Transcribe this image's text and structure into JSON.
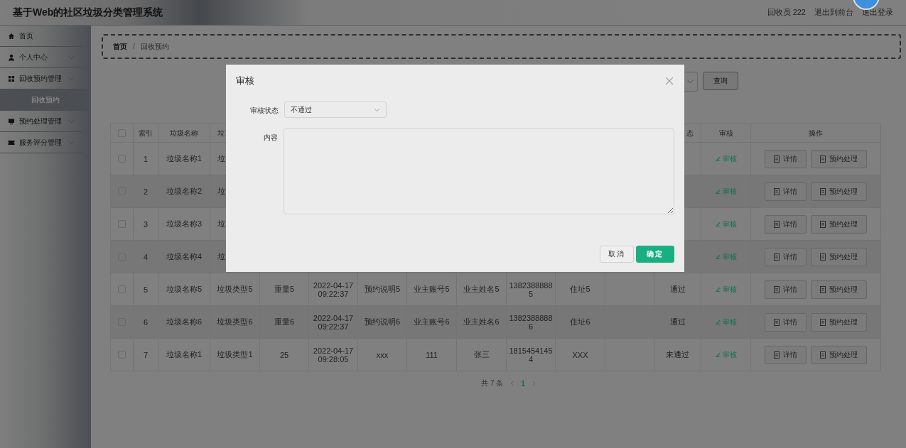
{
  "header": {
    "title": "基于Web的社区垃圾分类管理系统",
    "user": "回收员 222",
    "links": [
      "退出到前台",
      "退出登录"
    ]
  },
  "sidebar": {
    "items": [
      {
        "label": "首页",
        "collapsible": false
      },
      {
        "label": "个人中心",
        "collapsible": true
      },
      {
        "label": "回收预约管理",
        "collapsible": true,
        "children": [
          {
            "label": "回收预约",
            "selected": true
          }
        ]
      },
      {
        "label": "预约处理管理",
        "collapsible": true
      },
      {
        "label": "服务评分管理",
        "collapsible": true
      }
    ]
  },
  "breadcrumb": {
    "items": [
      "首页",
      "回收预约"
    ],
    "separator": "/"
  },
  "search": {
    "button": "查询"
  },
  "table": {
    "header_checkbox": {
      "checked": false
    },
    "columns": [
      "索引",
      "垃圾名称",
      "垃",
      null,
      null,
      null,
      null,
      null,
      null,
      null,
      null,
      "态",
      "审核",
      "操作"
    ],
    "rows": [
      {
        "kind": "covered",
        "checked": false,
        "cells": [
          "1",
          "垃圾名称1",
          "垃",
          null,
          null,
          null,
          null,
          null,
          null,
          null,
          null,
          null
        ],
        "review": "审核",
        "actions": [
          "详情",
          "预约处理"
        ]
      },
      {
        "kind": "covered",
        "checked": false,
        "cells": [
          "2",
          "垃圾名称2",
          "垃",
          null,
          null,
          null,
          null,
          null,
          null,
          null,
          null,
          null
        ],
        "review": "审核",
        "actions": [
          "详情",
          "预约处理"
        ]
      },
      {
        "kind": "covered",
        "checked": false,
        "cells": [
          "3",
          "垃圾名称3",
          "垃",
          null,
          null,
          null,
          null,
          null,
          null,
          null,
          null,
          null
        ],
        "review": "审核",
        "actions": [
          "详情",
          "预约处理"
        ]
      },
      {
        "kind": "covered",
        "checked": false,
        "cells": [
          "4",
          "垃圾名称4",
          "垃",
          null,
          null,
          null,
          null,
          null,
          null,
          null,
          null,
          null
        ],
        "review": "审核",
        "actions": [
          "详情",
          "预约处理"
        ]
      },
      {
        "kind": "full",
        "checked": false,
        "cells": [
          "5",
          "垃圾名称5",
          "垃圾类型5",
          "重量5",
          "2022-04-17 09:22:37",
          "预约说明5",
          "业主账号5",
          "业主姓名5",
          "13823888885",
          "住址5",
          null,
          "通过"
        ],
        "review": "审核",
        "actions": [
          "详情",
          "预约处理"
        ]
      },
      {
        "kind": "full",
        "checked": false,
        "cells": [
          "6",
          "垃圾名称6",
          "垃圾类型6",
          "重量6",
          "2022-04-17 09:22:37",
          "预约说明6",
          "业主账号6",
          "业主姓名6",
          "13823888886",
          "住址6",
          null,
          "通过"
        ],
        "review": "审核",
        "actions": [
          "详情",
          "预约处理"
        ]
      },
      {
        "kind": "full",
        "checked": false,
        "cells": [
          "7",
          "垃圾名称1",
          "垃圾类型1",
          "25",
          "2022-04-17 09:28:05",
          "xxx",
          "111",
          "张三",
          "18154541454",
          "XXX",
          null,
          "未通过"
        ],
        "review": "审核",
        "actions": [
          "详情",
          "预约处理"
        ]
      }
    ]
  },
  "pagination": {
    "total": "共 7 条",
    "pages": [
      {
        "label": "1",
        "selected": true
      }
    ]
  },
  "dialog": {
    "title": "审核",
    "fields": [
      {
        "label": "审核状态",
        "kind": "select",
        "value": "不通过"
      },
      {
        "label": "内容",
        "kind": "textarea"
      }
    ],
    "buttons": [
      {
        "label": "取消",
        "kind": "default"
      },
      {
        "label": "确定",
        "kind": "primary"
      }
    ]
  }
}
